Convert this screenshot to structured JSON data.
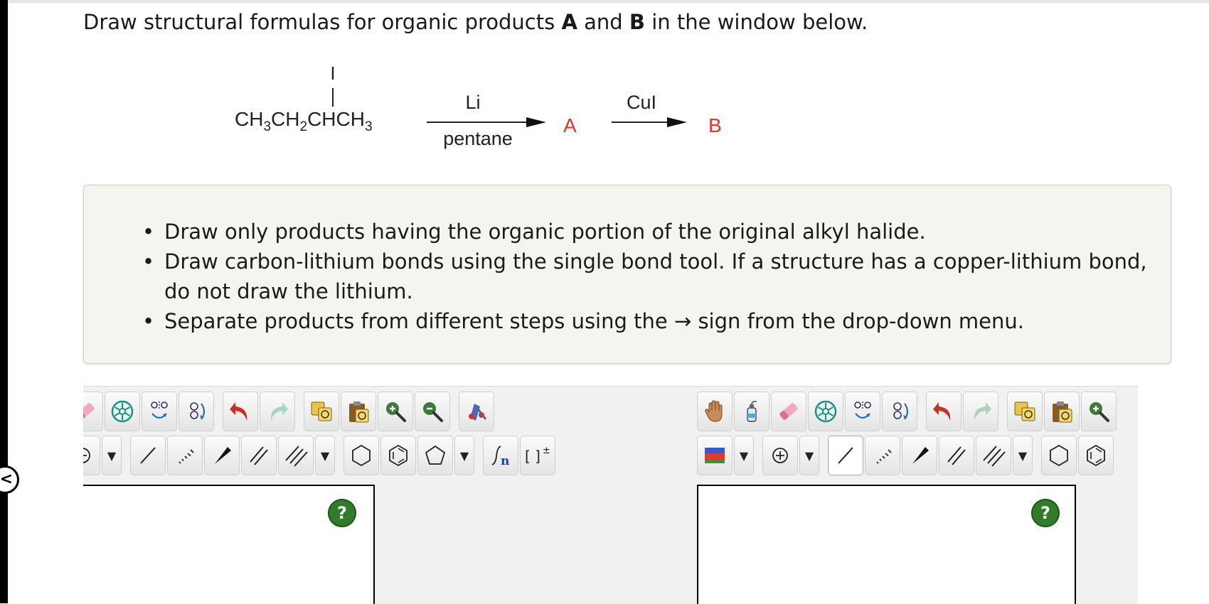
{
  "question": {
    "prefix": "Draw structural formulas for organic products ",
    "a": "A",
    "mid": " and ",
    "b": "B",
    "suffix": " in the window below."
  },
  "reaction": {
    "substituent": "I",
    "substrate": "CH3CH2CHCH3",
    "step1_above": "Li",
    "step1_below": "pentane",
    "product_a": "A",
    "step2_above": "CuI",
    "product_b": "B",
    "product_color": "#e8352b"
  },
  "instructions": [
    "Draw only products having the organic portion of the original alkyl halide.",
    "Draw carbon-lithium bonds using the single bond tool. If a structure has a copper-lithium bond, do not draw the lithium.",
    "Separate products from different steps using the → sign from the drop-down menu."
  ],
  "sketcher_left": {
    "toolbar_row1": [
      "eraser-icon",
      "ring-template-icon",
      "flip-horizontal-icon",
      "rotate-icon",
      "undo-icon",
      "redo-icon",
      "copy-icon",
      "paste-icon",
      "zoom-in-icon",
      "zoom-out-icon",
      "clean-structure-icon"
    ],
    "toolbar_row2": [
      "charge-plus-icon",
      "dropdown-arrow",
      "single-bond-icon",
      "hashed-wedge-bond-icon",
      "solid-wedge-bond-icon",
      "double-bond-icon",
      "triple-bond-icon",
      "dropdown-arrow",
      "hexagon-icon",
      "benzene-icon",
      "pentagon-icon",
      "dropdown-arrow",
      "sgroup-repeat-icon",
      "bracket-charge-icon"
    ],
    "help_label": "?"
  },
  "sketcher_right": {
    "toolbar_row1": [
      "hand-icon",
      "lasso-icon",
      "eraser-icon",
      "ring-template-icon",
      "flip-horizontal-icon",
      "rotate-icon",
      "undo-icon",
      "redo-icon",
      "copy-icon",
      "paste-icon",
      "zoom-in-icon"
    ],
    "toolbar_row2": [
      "color-fill-icon",
      "dropdown-arrow",
      "charge-plus-icon",
      "dropdown-arrow",
      "single-bond-icon",
      "hashed-wedge-bond-icon",
      "solid-wedge-bond-icon",
      "double-bond-icon",
      "triple-bond-icon",
      "dropdown-arrow",
      "hexagon-icon",
      "benzene-icon"
    ],
    "selected_tool": "single-bond-icon",
    "help_label": "?"
  },
  "colors": {
    "help_button": "#2f7d2a",
    "undo": "#c8321e",
    "instruction_bg": "#f4f5ef"
  }
}
